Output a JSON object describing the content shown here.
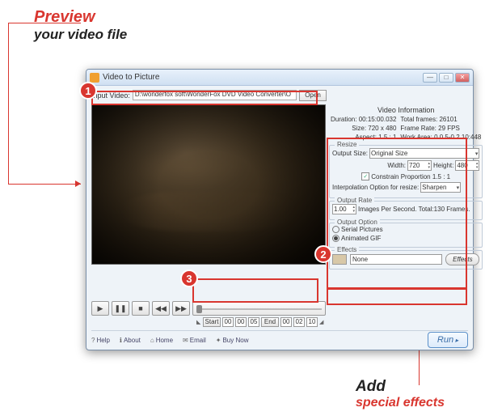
{
  "callout_top": {
    "red": "Preview",
    "black": "your video file"
  },
  "callout_bot": {
    "black": "Add",
    "red": "special effects"
  },
  "badges": {
    "b1": "1",
    "b2": "2",
    "b3": "3"
  },
  "window": {
    "title": "Video to Picture",
    "input_label": "Input Video:",
    "input_path": "D:\\wonderfox soft\\WonderFox DVD Video Converter\\O",
    "open": "Open"
  },
  "info": {
    "header": "Video Information",
    "duration_l": "Duration:",
    "duration_v": "00:15:00.032",
    "size_l": "Size:",
    "size_v": "720 x 480",
    "aspect_l": "Aspect:",
    "aspect_v": "1.5 : 1",
    "tf_l": "Total frames:",
    "tf_v": "26101",
    "fr_l": "Frame Rate:",
    "fr_v": "29 FPS",
    "wa_l": "Work Area:",
    "wa_v": "0.0.5-0.2.10:448"
  },
  "resize": {
    "title": "Resize",
    "os_l": "Output Size:",
    "os_v": "Original Size",
    "w_l": "Width:",
    "w_v": "720",
    "h_l": "Height:",
    "h_v": "480",
    "cp_l": "Constrain Proportion  1.5 : 1",
    "interp_l": "Interpolation Option for resize:",
    "interp_v": "Sharpen"
  },
  "rate": {
    "title": "Output Rate",
    "val": "1.00",
    "text": "Images Per Second. Total:130 Frames."
  },
  "option": {
    "title": "Output Option",
    "o1": "Serial Pictures",
    "o2": "Animated GIF"
  },
  "effects": {
    "title": "Effects",
    "val": "None",
    "btn": "Effects"
  },
  "range": {
    "start": "Start",
    "end": "End",
    "s1": "00",
    "s2": "00",
    "s3": "05",
    "e1": "00",
    "e2": "02",
    "e3": "10"
  },
  "bottom": {
    "help": "Help",
    "about": "About",
    "home": "Home",
    "email": "Email",
    "buy": "Buy Now",
    "run": "Run"
  }
}
